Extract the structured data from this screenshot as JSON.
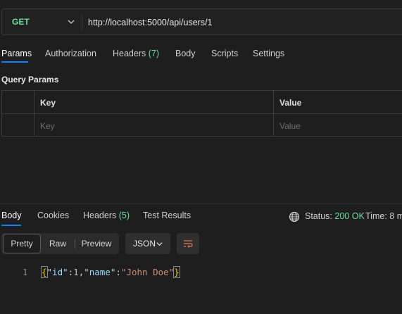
{
  "request": {
    "method": "GET",
    "url": "http://localhost:5000/api/users/1"
  },
  "request_tabs": [
    {
      "label": "Params"
    },
    {
      "label": "Authorization"
    },
    {
      "label": "Headers",
      "count": "(7)"
    },
    {
      "label": "Body"
    },
    {
      "label": "Scripts"
    },
    {
      "label": "Settings"
    }
  ],
  "query_params": {
    "title": "Query Params",
    "columns": [
      "Key",
      "Value"
    ],
    "placeholders": [
      "Key",
      "Value"
    ]
  },
  "response_tabs": [
    {
      "label": "Body"
    },
    {
      "label": "Cookies"
    },
    {
      "label": "Headers",
      "count": "(5)"
    },
    {
      "label": "Test Results"
    }
  ],
  "status": {
    "label": "Status:",
    "value": "200 OK",
    "time_label": "Time:",
    "time_value": "8 m"
  },
  "view_modes": [
    "Pretty",
    "Raw",
    "Preview"
  ],
  "format": "JSON",
  "response_body": {
    "line_number": "1",
    "open_brace": "{",
    "key1": "\"id\"",
    "colon1": ":",
    "val1": "1",
    "comma": ",",
    "key2": "\"name\"",
    "colon2": ":",
    "val2": "\"John Doe\"",
    "close_brace": "}"
  },
  "colors": {
    "accent": "#0a84ff",
    "method_get": "#6bdd9a",
    "status_ok": "#6bdd9a"
  }
}
